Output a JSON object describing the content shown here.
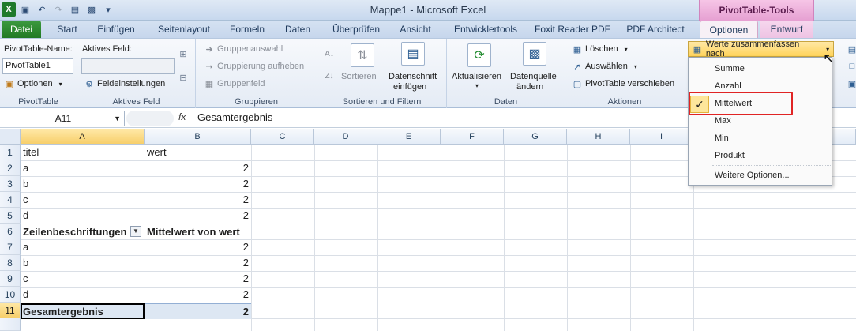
{
  "titlebar": {
    "title": "Mappe1  -  Microsoft Excel",
    "contextual_header": "PivotTable-Tools",
    "qat": [
      "save-icon",
      "undo-icon",
      "redo-icon",
      "print-preview-icon",
      "chart-icon",
      "customize-icon"
    ]
  },
  "tabs": {
    "file": "Datei",
    "items": [
      "Start",
      "Einfügen",
      "Seitenlayout",
      "Formeln",
      "Daten",
      "Überprüfen",
      "Ansicht",
      "Entwicklertools",
      "Foxit Reader PDF",
      "PDF Architect",
      "Optionen",
      "Entwurf"
    ]
  },
  "ribbon": {
    "pivottable": {
      "name_label": "PivotTable-Name:",
      "name_value": "PivotTable1",
      "options": "Optionen",
      "group": "PivotTable"
    },
    "active_field": {
      "label": "Aktives Feld:",
      "value": "",
      "settings": "Feldeinstellungen",
      "group": "Aktives Feld"
    },
    "group_items": {
      "selection": "Gruppenauswahl",
      "ungroup": "Gruppierung aufheben",
      "field": "Gruppenfeld",
      "group": "Gruppieren"
    },
    "sort": {
      "sort": "Sortieren",
      "slicer1": "Datenschnitt",
      "slicer2": "einfügen",
      "group": "Sortieren und Filtern"
    },
    "data": {
      "refresh": "Aktualisieren",
      "source1": "Datenquelle",
      "source2": "ändern",
      "group": "Daten"
    },
    "actions": {
      "clear": "Löschen",
      "select": "Auswählen",
      "move": "PivotTable verschieben",
      "group": "Aktionen"
    }
  },
  "dropdown": {
    "button": "Werte zusammenfassen nach",
    "items": [
      "Summe",
      "Anzahl",
      "Mittelwert",
      "Max",
      "Min",
      "Produkt"
    ],
    "more": "Weitere Optionen...",
    "selected": "Mittelwert"
  },
  "formula": {
    "namebox": "A11",
    "fx": "fx",
    "content": "Gesamtergebnis"
  },
  "grid": {
    "columns": [
      "A",
      "B",
      "C",
      "D",
      "E",
      "F",
      "G",
      "H",
      "I"
    ],
    "rows": [
      "1",
      "2",
      "3",
      "4",
      "5",
      "6",
      "7",
      "8",
      "9",
      "10",
      "11"
    ],
    "cells": {
      "a1": "titel",
      "b1": "wert",
      "a2": "a",
      "b2": "2",
      "a3": "b",
      "b3": "2",
      "a4": "c",
      "b4": "2",
      "a5": "d",
      "b5": "2",
      "a6": "Zeilenbeschriftungen",
      "b6": "Mittelwert von wert",
      "a7": "a",
      "b7": "2",
      "a8": "b",
      "b8": "2",
      "a9": "c",
      "b9": "2",
      "a10": "d",
      "b10": "2",
      "a11": "Gesamtergebnis",
      "b11": "2"
    }
  }
}
